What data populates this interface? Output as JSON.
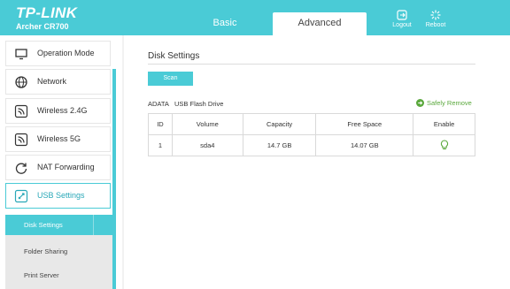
{
  "brand": {
    "logo": "TP-LINK",
    "model": "Archer CR700"
  },
  "tabs": {
    "basic": "Basic",
    "advanced": "Advanced"
  },
  "header_buttons": {
    "logout": "Logout",
    "reboot": "Reboot"
  },
  "sidebar": {
    "items": [
      {
        "label": "Operation Mode",
        "icon": "monitor-icon"
      },
      {
        "label": "Network",
        "icon": "globe-icon"
      },
      {
        "label": "Wireless 2.4G",
        "icon": "wifi-icon"
      },
      {
        "label": "Wireless 5G",
        "icon": "wifi-icon"
      },
      {
        "label": "NAT Forwarding",
        "icon": "nat-icon"
      },
      {
        "label": "USB Settings",
        "icon": "usb-icon"
      }
    ],
    "sub_items": [
      "Disk Settings",
      "Folder Sharing",
      "Print Server"
    ]
  },
  "main": {
    "title": "Disk Settings",
    "scan_label": "Scan",
    "drive_name": "ADATA",
    "drive_type": "USB Flash Drive",
    "safely_remove": "Safely Remove",
    "table": {
      "headers": [
        "ID",
        "Volume",
        "Capacity",
        "Free Space",
        "Enable"
      ],
      "rows": [
        {
          "id": "1",
          "volume": "sda4",
          "capacity": "14.7 GB",
          "free": "14.07 GB"
        }
      ]
    }
  },
  "colors": {
    "accent": "#4acbd6",
    "enable_green": "#5aa83c"
  }
}
